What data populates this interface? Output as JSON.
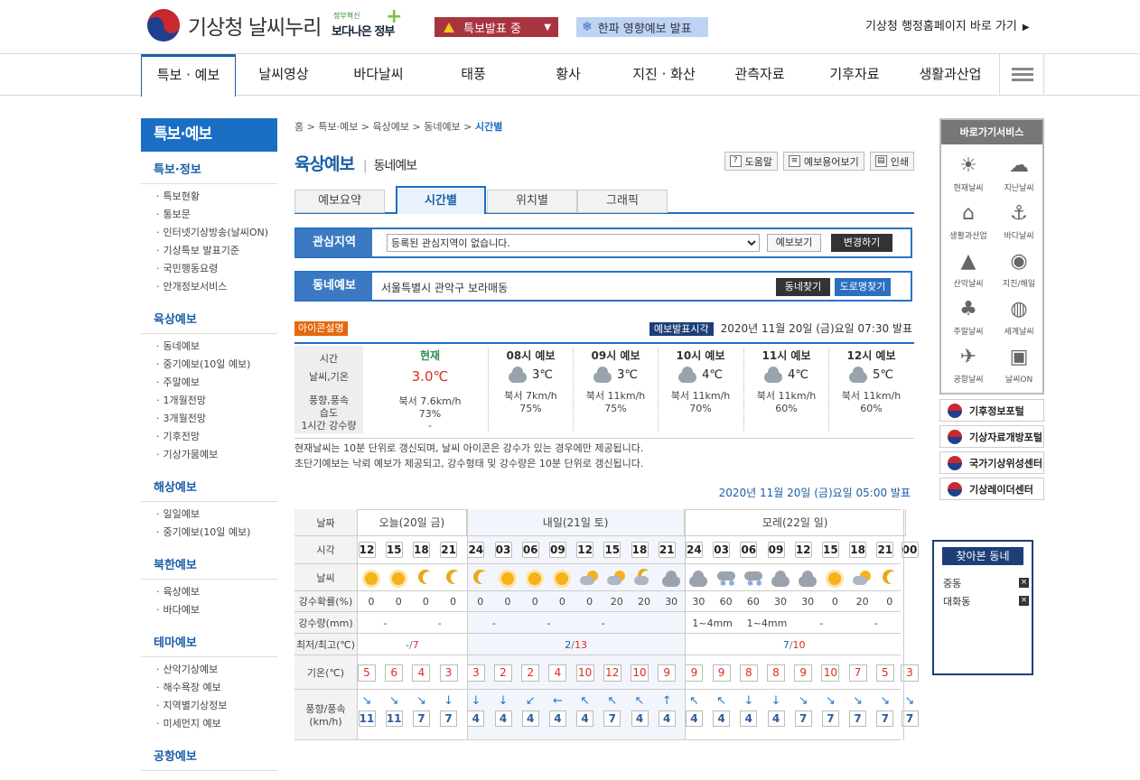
{
  "header": {
    "logo_text": "기상청 날씨누리",
    "slogan_top": "정부혁신",
    "slogan_main": "보다나은 정부",
    "alert_label": "특보발표 중",
    "cold_label": "한파 영향예보 발표",
    "kma_link": "기상청 행정홈페이지 바로 가기"
  },
  "gnb": [
    "특보 · 예보",
    "날씨영상",
    "바다날씨",
    "태풍",
    "황사",
    "지진 · 화산",
    "관측자료",
    "기후자료",
    "생활과산업"
  ],
  "lnb": {
    "title": "특보·예보",
    "sections": [
      {
        "title": "특보·정보",
        "items": [
          "특보현황",
          "통보문",
          "인터넷기상방송(날씨ON)",
          "기상특보 발표기준",
          "국민행동요령",
          "안개정보서비스"
        ]
      },
      {
        "title": "육상예보",
        "items": [
          "동네예보",
          "중기예보(10일 예보)",
          "주말예보",
          "1개월전망",
          "3개월전망",
          "기후전망",
          "기상가뭄예보"
        ]
      },
      {
        "title": "해상예보",
        "items": [
          "일일예보",
          "중기예보(10일 예보)"
        ]
      },
      {
        "title": "북한예보",
        "items": [
          "육상예보",
          "바다예보"
        ]
      },
      {
        "title": "테마예보",
        "items": [
          "산악기상예보",
          "해수욕장 예보",
          "지역별기상정보",
          "미세먼지 예보"
        ]
      },
      {
        "title": "공항예보",
        "items": []
      }
    ]
  },
  "breadcrumb": [
    "홈",
    "특보·예보",
    "육상예보",
    "동네예보",
    "시간별"
  ],
  "page": {
    "title": "육상예보",
    "subtitle": "동네예보",
    "tools": [
      "도움말",
      "예보용어보기",
      "인쇄"
    ],
    "tabs": [
      "예보요약",
      "시간별",
      "위치별",
      "그래픽"
    ],
    "interest_label": "관심지역",
    "interest_value": "등록된 관심지역이 없습니다.",
    "btn_view": "예보보기",
    "btn_change": "변경하기",
    "dong_label": "동네예보",
    "dong_value": "서울특별시 관악구 보라매동",
    "btn_find": "동네찾기",
    "btn_road": "도로명찾기",
    "icon_badge": "아이콘설명",
    "issue_tag": "예보발표시각",
    "issue_time": "2020년 11월 20일 (금)요일 07:30 발표",
    "note1": "현재날씨는 10분 단위로 갱신되며, 날씨 아이콘은 강수가 있는 경우에만 제공됩니다.",
    "note2": "초단기예보는 낙뢰 예보가 제공되고, 강수형태 및 강수량은 10분 단위로 갱신됩니다.",
    "issue_time2": "2020년 11월 20일 (금)요일 05:00 발표"
  },
  "current": {
    "left_labels": [
      "시간",
      "날씨,기온",
      "풍향,풍속",
      "습도",
      "1시간 강수량"
    ],
    "now_title": "현재",
    "now_temp": "3.0℃",
    "now_wind": "북서 7.6km/h",
    "now_humidity": "73%",
    "now_rain": "-",
    "forecasts": [
      {
        "title": "08시 예보",
        "temp": "3℃",
        "wind": "북서 7km/h",
        "humidity": "75%"
      },
      {
        "title": "09시 예보",
        "temp": "3℃",
        "wind": "북서 11km/h",
        "humidity": "75%"
      },
      {
        "title": "10시 예보",
        "temp": "4℃",
        "wind": "북서 11km/h",
        "humidity": "70%"
      },
      {
        "title": "11시 예보",
        "temp": "4℃",
        "wind": "북서 11km/h",
        "humidity": "60%"
      },
      {
        "title": "12시 예보",
        "temp": "5℃",
        "wind": "북서 11km/h",
        "humidity": "60%"
      }
    ]
  },
  "grid": {
    "row_labels": [
      "날짜",
      "시각",
      "날씨",
      "강수확률(%)",
      "강수량(mm)",
      "최저/최고(℃)",
      "기온(℃)",
      "풍향/풍속(km/h)"
    ],
    "days": [
      "오늘(20일 금)",
      "내일(21일 토)",
      "모레(22일 일)"
    ],
    "hours": [
      "12",
      "15",
      "18",
      "21",
      "24",
      "03",
      "06",
      "09",
      "12",
      "15",
      "18",
      "21",
      "24",
      "03",
      "06",
      "09",
      "12",
      "15",
      "18",
      "21",
      "00"
    ],
    "weather": [
      "sun",
      "sun",
      "moon",
      "moon",
      "moon",
      "sun",
      "sun",
      "sun",
      "sun-cloud",
      "sun-cloud",
      "moon-cloud",
      "cloud",
      "cloud",
      "snow-rain",
      "snow-rain",
      "cloud",
      "cloud",
      "sun",
      "sun-cloud",
      "moon"
    ],
    "pop": [
      "0",
      "0",
      "0",
      "0",
      "0",
      "0",
      "0",
      "0",
      "0",
      "20",
      "20",
      "30",
      "30",
      "60",
      "60",
      "30",
      "30",
      "0",
      "20",
      "0"
    ],
    "rain": [
      "-",
      "-",
      "-",
      "-",
      "-",
      "1~4mm",
      "1~4mm",
      "-",
      "-"
    ],
    "minmax": [
      {
        "min": "-",
        "max": "7"
      },
      {
        "min": "2",
        "max": "13"
      },
      {
        "min": "7",
        "max": "10"
      }
    ],
    "temps": [
      "5",
      "6",
      "4",
      "3",
      "3",
      "2",
      "2",
      "4",
      "10",
      "12",
      "10",
      "9",
      "9",
      "9",
      "8",
      "8",
      "9",
      "10",
      "7",
      "5",
      "3"
    ],
    "wind_dirs": [
      "↘",
      "↘",
      "↘",
      "↓",
      "↓",
      "↓",
      "↙",
      "←",
      "↖",
      "↖",
      "↖",
      "↑",
      "↖",
      "↖",
      "↓",
      "↓",
      "↘",
      "↘",
      "↘",
      "↘",
      "↘"
    ],
    "wind_speeds": [
      "11",
      "11",
      "7",
      "7",
      "4",
      "4",
      "4",
      "4",
      "4",
      "7",
      "4",
      "4",
      "4",
      "4",
      "4",
      "4",
      "7",
      "7",
      "7",
      "7",
      "7"
    ]
  },
  "quick": {
    "title": "바로가기서비스",
    "items": [
      "현재날씨",
      "지난날씨",
      "생활과산업",
      "바다날씨",
      "산악날씨",
      "지진/해일",
      "주말날씨",
      "세계날씨",
      "공항날씨",
      "날씨ON"
    ],
    "portals": [
      "기후정보포털",
      "기상자료개방포털",
      "국가기상위성센터",
      "기상레이더센터"
    ]
  },
  "visited": {
    "title": "찾아본 동네",
    "items": [
      "중동",
      "대화동"
    ]
  },
  "colors": {
    "brand": "#1a6fc4",
    "alert": "#a8343f",
    "temp_red": "#d92d20"
  }
}
